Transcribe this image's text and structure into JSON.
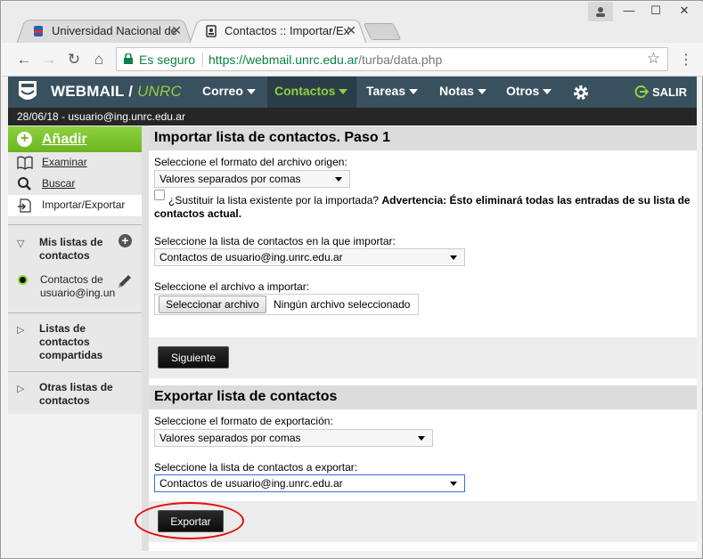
{
  "browser": {
    "tabs": [
      {
        "title": "Universidad Nacional de",
        "active": false
      },
      {
        "title": "Contactos :: Importar/Exp",
        "active": true
      }
    ],
    "secure_label": "Es seguro",
    "url_host": "https://webmail.unrc.edu.ar",
    "url_path": "/turba/data.php"
  },
  "app": {
    "brand_main": "WEBMAIL / ",
    "brand_accent": "UNRC",
    "menus": [
      {
        "label": "Correo"
      },
      {
        "label": "Contactos"
      },
      {
        "label": "Tareas"
      },
      {
        "label": "Notas"
      },
      {
        "label": "Otros"
      }
    ],
    "logout_label": "SALIR",
    "user_line": "28/06/18 - usuario@ing.unrc.edu.ar",
    "colors": {
      "header": "#39505e",
      "accent": "#8fd13f",
      "userbar": "#262626"
    }
  },
  "sidebar": {
    "add_label": "Añadir",
    "items": [
      {
        "label": "Examinar",
        "icon": "book-icon"
      },
      {
        "label": "Buscar",
        "icon": "search-icon"
      },
      {
        "label": "Importar/Exportar",
        "icon": "import-export-icon"
      }
    ],
    "my_lists_label": "Mis listas de contactos",
    "my_list_name": "Contactos de usuario@ing.un",
    "shared_lists_label": "Listas de contactos compartidas",
    "other_lists_label": "Otras listas de contactos"
  },
  "import": {
    "title": "Importar lista de contactos. Paso 1",
    "format_label": "Seleccione el formato del archivo origen:",
    "format_value": "Valores separados por comas",
    "replace_label": "¿Sustituir la lista existente por la importada?",
    "warning": "Advertencia: Ésto eliminará todas las entradas de su lista de contactos actual.",
    "target_label": "Seleccione la lista de contactos en la que importar:",
    "target_value": "Contactos de usuario@ing.unrc.edu.ar",
    "file_label": "Seleccione el archivo a importar:",
    "file_button": "Seleccionar archivo",
    "file_status": "Ningún archivo seleccionado",
    "next_button": "Siguiente"
  },
  "export": {
    "title": "Exportar lista de contactos",
    "format_label": "Seleccione el formato de exportación:",
    "format_value": "Valores separados por comas",
    "source_label": "Seleccione la lista de contactos a exportar:",
    "source_value": "Contactos de usuario@ing.unrc.edu.ar",
    "export_button": "Exportar"
  }
}
